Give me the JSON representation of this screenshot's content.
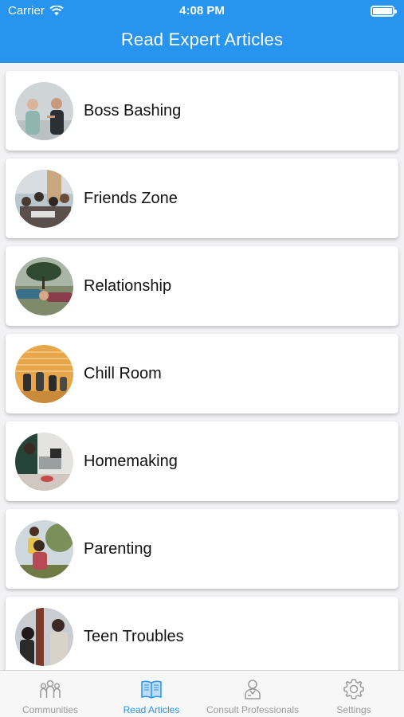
{
  "status_bar": {
    "carrier": "Carrier",
    "time": "4:08 PM"
  },
  "nav": {
    "title": "Read Expert Articles"
  },
  "articles": [
    {
      "label": "Boss Bashing",
      "image": "office-argument-photo"
    },
    {
      "label": "Friends Zone",
      "image": "friends-group-photo"
    },
    {
      "label": "Relationship",
      "image": "holding-hands-photo"
    },
    {
      "label": "Chill Room",
      "image": "relaxing-group-photo"
    },
    {
      "label": "Homemaking",
      "image": "kitchen-photo"
    },
    {
      "label": "Parenting",
      "image": "parent-child-photo"
    },
    {
      "label": "Teen Troubles",
      "image": "teens-photo"
    }
  ],
  "tabs": [
    {
      "label": "Communities",
      "icon": "people-icon",
      "active": false
    },
    {
      "label": "Read Articles",
      "icon": "book-icon",
      "active": true
    },
    {
      "label": "Consult Professionals",
      "icon": "professional-icon",
      "active": false
    },
    {
      "label": "Settings",
      "icon": "gear-icon",
      "active": false
    }
  ],
  "colors": {
    "accent": "#2794ef",
    "inactive_tab": "#9a9a9a"
  }
}
